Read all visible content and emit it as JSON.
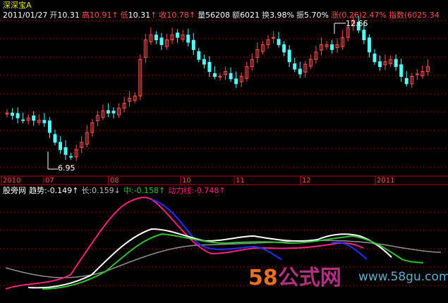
{
  "app": {
    "title": "深深宝A"
  },
  "quote": {
    "date": "2011/01/27",
    "open_label": "开",
    "open": "10.31",
    "high_label": "高",
    "high": "10.91",
    "low_label": "低",
    "low": "10.31",
    "close_label": "收",
    "close": "10.78",
    "volume_label": "量",
    "volume": "56208",
    "amount_label": "额",
    "amount": "6021",
    "turnover_label": "换",
    "turnover": "3.98%",
    "amplitude_label": "振",
    "amplitude": "5.70%",
    "change_label": "涨",
    "change": "(0.26)",
    "change_pct": "2.47%",
    "index_label": "指数",
    "index": "(6025.34"
  },
  "indicator": {
    "name": "股旁网",
    "trend_label": "趋势",
    "trend": "-0.149",
    "long_label": "长",
    "long": "0.159",
    "mid_label": "中",
    "mid": "-0.158",
    "power_label": "动力线",
    "power": "-0.748"
  },
  "watermark": {
    "text": "58公式网",
    "url": "www.58gu.com"
  },
  "colors": {
    "up": "#ff5050",
    "down": "#54fcfc",
    "grid": "#a00000",
    "white_line": "#ffffff",
    "gray_line": "#909090",
    "green_line": "#30c030",
    "blue_line": "#2030ff",
    "magenta_line": "#ff2080"
  },
  "chart_data": {
    "type": "candlestick",
    "x_tick_labels": [
      "2010",
      "07",
      "08",
      "10",
      "11",
      "12",
      "2011"
    ],
    "annotations": [
      {
        "text": "6.95"
      },
      {
        "text": "12.66"
      }
    ],
    "price_range": [
      6.5,
      13.0
    ],
    "close_series": [
      8.8,
      8.7,
      8.6,
      8.5,
      8.6,
      8.5,
      8.5,
      8.4,
      8.0,
      7.6,
      7.3,
      7.1,
      7.0,
      7.3,
      7.6,
      8.0,
      8.4,
      8.7,
      8.9,
      8.8,
      8.8,
      9.0,
      9.2,
      9.4,
      9.5,
      11.0,
      11.8,
      12.0,
      11.8,
      11.6,
      11.8,
      12.0,
      11.9,
      12.0,
      11.7,
      11.4,
      11.0,
      10.8,
      10.5,
      10.3,
      10.3,
      10.5,
      10.2,
      10.0,
      10.3,
      10.7,
      11.0,
      11.4,
      11.6,
      11.8,
      11.9,
      11.6,
      11.3,
      10.9,
      10.6,
      10.4,
      10.8,
      11.0,
      11.3,
      11.6,
      11.6,
      11.4,
      11.6,
      11.9,
      12.3,
      12.6,
      12.2,
      11.8,
      11.3,
      10.9,
      10.7,
      10.9,
      11.0,
      10.7,
      10.3,
      10.0,
      10.3,
      10.4,
      10.5,
      10.7
    ]
  }
}
